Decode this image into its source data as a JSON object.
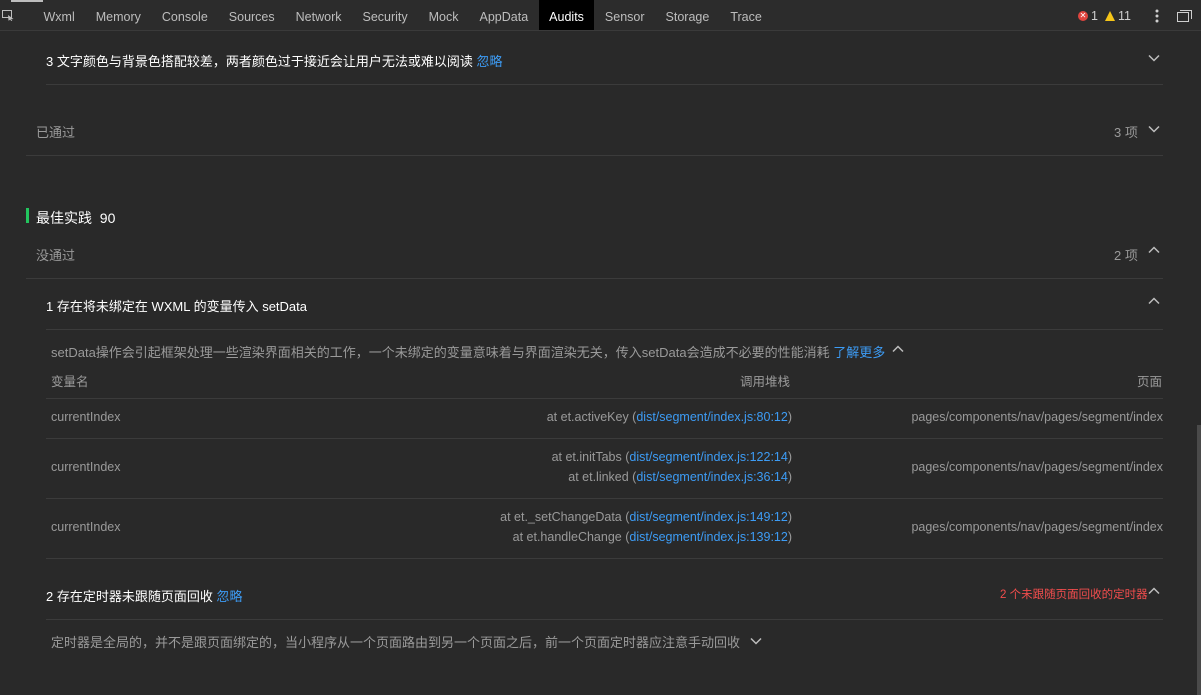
{
  "tabs": [
    {
      "label": "Wxml",
      "active": false
    },
    {
      "label": "Memory",
      "active": false
    },
    {
      "label": "Console",
      "active": false
    },
    {
      "label": "Sources",
      "active": false
    },
    {
      "label": "Network",
      "active": false
    },
    {
      "label": "Security",
      "active": false
    },
    {
      "label": "Mock",
      "active": false
    },
    {
      "label": "AppData",
      "active": false
    },
    {
      "label": "Audits",
      "active": true
    },
    {
      "label": "Sensor",
      "active": false
    },
    {
      "label": "Storage",
      "active": false
    },
    {
      "label": "Trace",
      "active": false
    }
  ],
  "counters": {
    "errors": "1",
    "warnings": "11"
  },
  "colors": {
    "accent": "#22c55e",
    "link": "#3d9cf5",
    "error": "#e0443e",
    "warning": "#f5c518",
    "alert_text": "#f24d4d",
    "active_tab_bg": "#000000"
  },
  "accessibility": {
    "item3_title": "3 文字颜色与背景色搭配较差，两者颜色过于接近会让用户无法或难以阅读",
    "item3_ignore": "忽略",
    "passed_label": "已通过",
    "passed_count": "3 项"
  },
  "best_practice": {
    "title": "最佳实践",
    "score": "90",
    "failed_label": "没通过",
    "failed_count": "2 项",
    "item1": {
      "title": "1 存在将未绑定在 WXML 的变量传入 setData",
      "description": "setData操作会引起框架处理一些渲染界面相关的工作，一个未绑定的变量意味着与界面渲染无关，传入setData会造成不必要的性能消耗",
      "learn_more": "了解更多",
      "columns": {
        "variable": "变量名",
        "stack": "调用堆栈",
        "page": "页面"
      },
      "rows": [
        {
          "variable": "currentIndex",
          "page": "pages/components/nav/pages/segment/index",
          "stack": [
            {
              "fn": "at et.activeKey (",
              "link": "dist/segment/index.js:80:12",
              "close": ")"
            }
          ]
        },
        {
          "variable": "currentIndex",
          "page": "pages/components/nav/pages/segment/index",
          "stack": [
            {
              "fn": "at et.initTabs (",
              "link": "dist/segment/index.js:122:14",
              "close": ")"
            },
            {
              "fn": "at et.linked (",
              "link": "dist/segment/index.js:36:14",
              "close": ")"
            }
          ]
        },
        {
          "variable": "currentIndex",
          "page": "pages/components/nav/pages/segment/index",
          "stack": [
            {
              "fn": "at et._setChangeData (",
              "link": "dist/segment/index.js:149:12",
              "close": ")"
            },
            {
              "fn": "at et.handleChange (",
              "link": "dist/segment/index.js:139:12",
              "close": ")"
            }
          ]
        }
      ]
    },
    "item2": {
      "title": "2 存在定时器未跟随页面回收",
      "ignore": "忽略",
      "alert": "2 个未跟随页面回收的定时器",
      "description": "定时器是全局的，并不是跟页面绑定的，当小程序从一个页面路由到另一个页面之后，前一个页面定时器应注意手动回收"
    }
  }
}
